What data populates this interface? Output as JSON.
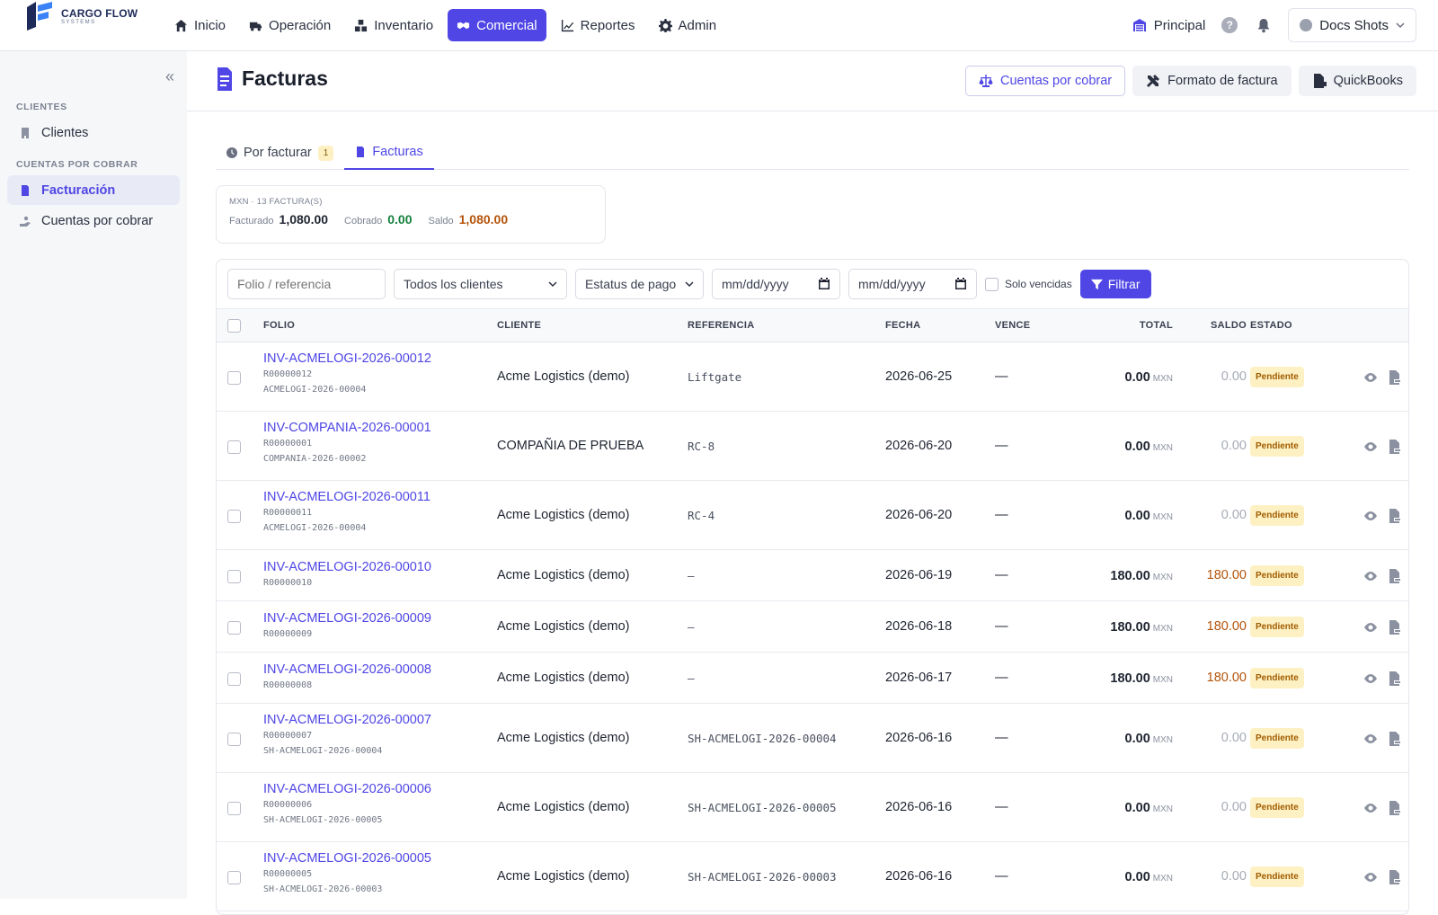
{
  "brand": {
    "line1": "CARGO FLOW",
    "line2": "SYSTEMS"
  },
  "nav": [
    {
      "label": "Inicio",
      "icon": "home-icon"
    },
    {
      "label": "Operación",
      "icon": "truck-icon"
    },
    {
      "label": "Inventario",
      "icon": "boxes-icon"
    },
    {
      "label": "Comercial",
      "icon": "handshake-icon",
      "active": true
    },
    {
      "label": "Reportes",
      "icon": "chart-line-icon"
    },
    {
      "label": "Admin",
      "icon": "gear-icon"
    }
  ],
  "topRight": {
    "branch": "Principal",
    "help": "?",
    "user": "Docs Shots"
  },
  "sidebar": {
    "sections": [
      {
        "title": "CLIENTES",
        "items": [
          {
            "label": "Clientes",
            "icon": "building-icon"
          }
        ]
      },
      {
        "title": "CUENTAS POR COBRAR",
        "items": [
          {
            "label": "Facturación",
            "icon": "invoice-icon",
            "active": true
          },
          {
            "label": "Cuentas por cobrar",
            "icon": "hand-coin-icon"
          }
        ]
      }
    ]
  },
  "page": {
    "title": "Facturas",
    "actions": {
      "receivables": "Cuentas por cobrar",
      "format": "Formato de factura",
      "qb": "QuickBooks"
    }
  },
  "tabs": [
    {
      "label": "Por facturar",
      "badge": "1"
    },
    {
      "label": "Facturas",
      "active": true
    }
  ],
  "summary": {
    "caption": "MXN · 13 FACTURA(S)",
    "billed_label": "Facturado",
    "billed": "1,080.00",
    "collected_label": "Cobrado",
    "collected": "0.00",
    "balance_label": "Saldo",
    "balance": "1,080.00",
    "colors": {
      "collected": "#15803d",
      "balance": "#b45309"
    }
  },
  "filters": {
    "search_placeholder": "Folio / referencia",
    "client": "Todos los clientes",
    "status": "Estatus de pago",
    "date_from": "mm/dd/yyyy",
    "date_to": "mm/dd/yyyy",
    "overdue": "Solo vencidas",
    "button": "Filtrar"
  },
  "table": {
    "headers": {
      "folio": "FOLIO",
      "client": "CLIENTE",
      "ref": "REFERENCIA",
      "date": "FECHA",
      "due": "VENCE",
      "total": "TOTAL",
      "balance": "SALDO",
      "status": "ESTADO"
    },
    "rows": [
      {
        "folio": "INV-ACMELOGI-2026-00012",
        "sub1": "R00000012",
        "sub2": "ACMELOGI-2026-00004",
        "client": "Acme Logistics (demo)",
        "ref": "Liftgate",
        "date": "2026-06-25",
        "due": "—",
        "total": "0.00",
        "cur": "MXN",
        "balance": "0.00",
        "status": "Pendiente"
      },
      {
        "folio": "INV-COMPANIA-2026-00001",
        "sub1": "R00000001",
        "sub2": "COMPANIA-2026-00002",
        "client": "COMPAÑIA DE PRUEBA",
        "ref": "RC-8",
        "date": "2026-06-20",
        "due": "—",
        "total": "0.00",
        "cur": "MXN",
        "balance": "0.00",
        "status": "Pendiente"
      },
      {
        "folio": "INV-ACMELOGI-2026-00011",
        "sub1": "R00000011",
        "sub2": "ACMELOGI-2026-00004",
        "client": "Acme Logistics (demo)",
        "ref": "RC-4",
        "date": "2026-06-20",
        "due": "—",
        "total": "0.00",
        "cur": "MXN",
        "balance": "0.00",
        "status": "Pendiente"
      },
      {
        "folio": "INV-ACMELOGI-2026-00010",
        "sub1": "R00000010",
        "sub2": "",
        "client": "Acme Logistics (demo)",
        "ref": "–",
        "date": "2026-06-19",
        "due": "—",
        "total": "180.00",
        "cur": "MXN",
        "balance": "180.00",
        "status": "Pendiente"
      },
      {
        "folio": "INV-ACMELOGI-2026-00009",
        "sub1": "R00000009",
        "sub2": "",
        "client": "Acme Logistics (demo)",
        "ref": "–",
        "date": "2026-06-18",
        "due": "—",
        "total": "180.00",
        "cur": "MXN",
        "balance": "180.00",
        "status": "Pendiente"
      },
      {
        "folio": "INV-ACMELOGI-2026-00008",
        "sub1": "R00000008",
        "sub2": "",
        "client": "Acme Logistics (demo)",
        "ref": "–",
        "date": "2026-06-17",
        "due": "—",
        "total": "180.00",
        "cur": "MXN",
        "balance": "180.00",
        "status": "Pendiente"
      },
      {
        "folio": "INV-ACMELOGI-2026-00007",
        "sub1": "R00000007",
        "sub2": "SH-ACMELOGI-2026-00004",
        "client": "Acme Logistics (demo)",
        "ref": "SH-ACMELOGI-2026-00004",
        "date": "2026-06-16",
        "due": "—",
        "total": "0.00",
        "cur": "MXN",
        "balance": "0.00",
        "status": "Pendiente"
      },
      {
        "folio": "INV-ACMELOGI-2026-00006",
        "sub1": "R00000006",
        "sub2": "SH-ACMELOGI-2026-00005",
        "client": "Acme Logistics (demo)",
        "ref": "SH-ACMELOGI-2026-00005",
        "date": "2026-06-16",
        "due": "—",
        "total": "0.00",
        "cur": "MXN",
        "balance": "0.00",
        "status": "Pendiente"
      },
      {
        "folio": "INV-ACMELOGI-2026-00005",
        "sub1": "R00000005",
        "sub2": "SH-ACMELOGI-2026-00003",
        "client": "Acme Logistics (demo)",
        "ref": "SH-ACMELOGI-2026-00003",
        "date": "2026-06-16",
        "due": "—",
        "total": "0.00",
        "cur": "MXN",
        "balance": "0.00",
        "status": "Pendiente"
      }
    ]
  }
}
